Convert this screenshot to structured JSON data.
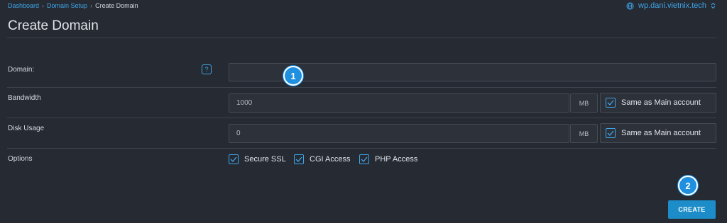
{
  "breadcrumb": {
    "items": [
      "Dashboard",
      "Domain Setup"
    ],
    "current": "Create Domain",
    "separator": "›"
  },
  "server": {
    "name": "wp.dani.vietnix.tech",
    "icon": "globe-icon"
  },
  "page": {
    "title": "Create Domain"
  },
  "form": {
    "domain": {
      "label": "Domain:",
      "value": "",
      "help_icon": "?"
    },
    "bandwidth": {
      "label": "Bandwidth",
      "placeholder": "1000",
      "unit": "MB",
      "same_label": "Same as Main account",
      "same_checked": true
    },
    "disk_usage": {
      "label": "Disk Usage",
      "placeholder": "0",
      "unit": "MB",
      "same_label": "Same as Main account",
      "same_checked": true
    },
    "options": {
      "label": "Options",
      "items": [
        {
          "label": "Secure SSL",
          "checked": true
        },
        {
          "label": "CGI Access",
          "checked": true
        },
        {
          "label": "PHP Access",
          "checked": true
        }
      ]
    }
  },
  "annotations": {
    "step1": "1",
    "step2": "2"
  },
  "actions": {
    "create_label": "CREATE"
  },
  "colors": {
    "background": "#252a33",
    "accent": "#3fa6e8",
    "button": "#1d8dc9",
    "badge": "#1f8fe0"
  }
}
